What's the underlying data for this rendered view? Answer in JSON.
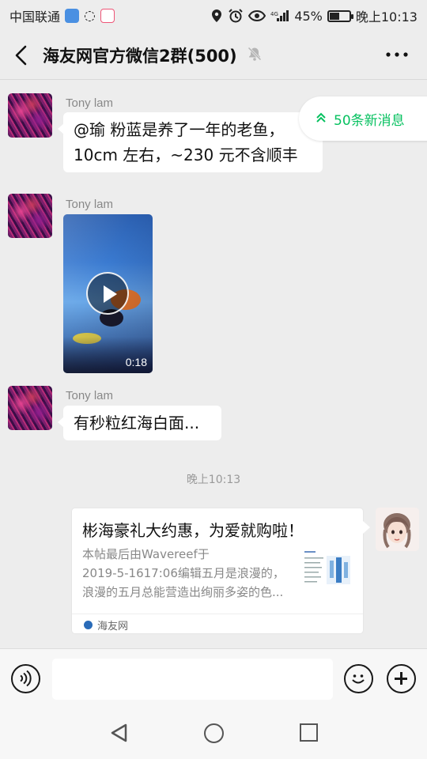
{
  "status_bar": {
    "carrier": "中国联通",
    "battery": "45%",
    "battery_level": 0.45,
    "time": "晚上10:13"
  },
  "header": {
    "title": "海友网官方微信2群(500)",
    "icons": [
      "back-arrow-icon",
      "mute-bell-icon",
      "more-dots-icon"
    ]
  },
  "new_messages": {
    "label": "50条新消息",
    "icon": "double-chevron-up-icon"
  },
  "messages": [
    {
      "sender": "Tony lam",
      "lines": [
        "@瑜  粉蓝是养了一年的老鱼，",
        "10cm 左右，~230 元不含顺丰"
      ]
    },
    {
      "sender": "Tony lam",
      "duration": "0:18"
    },
    {
      "sender": "Tony lam",
      "lines": [
        "有秒粒红海白面..."
      ]
    }
  ],
  "timestamp": "晚上10:13",
  "link_card": {
    "title": "彬海豪礼大约惠，为爱就购啦！",
    "desc_lines": [
      "本帖最后由Wavereef于",
      "2019-5-1617:06编辑五月是浪漫的，",
      "浪漫的五月总能营造出绚丽多姿的色..."
    ],
    "source": "海友网"
  },
  "input_bar": {
    "placeholder": "",
    "value": ""
  },
  "colors": {
    "accent": "#07c160",
    "background": "#ededed",
    "bubble": "#ffffff"
  }
}
